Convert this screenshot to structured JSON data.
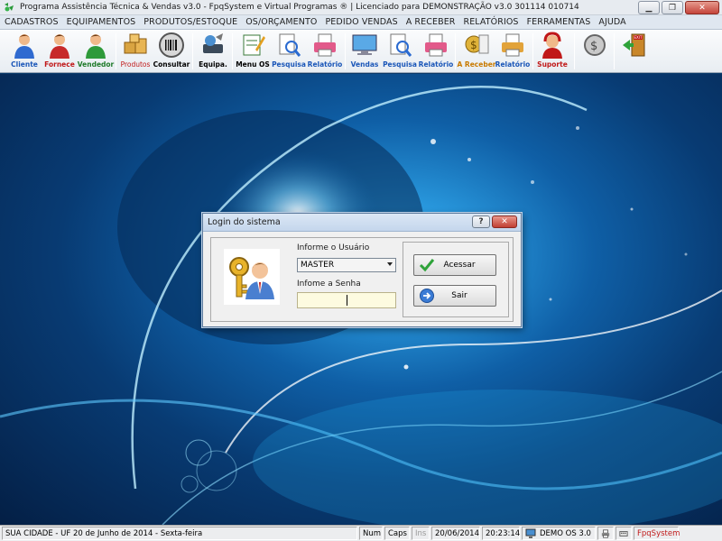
{
  "window": {
    "title": "Programa Assistência Técnica & Vendas v3.0 - FpqSystem e Virtual Programas ® | Licenciado para  DEMONSTRAÇÃO v3.0 301114 010714"
  },
  "menu": [
    "CADASTROS",
    "EQUIPAMENTOS",
    "PRODUTOS/ESTOQUE",
    "OS/ORÇAMENTO",
    "PEDIDO VENDAS",
    "A RECEBER",
    "RELATÓRIOS",
    "FERRAMENTAS",
    "AJUDA"
  ],
  "toolbar": {
    "cliente": "Cliente",
    "fornece": "Fornece",
    "vendedor": "Vendedor",
    "produtos": "Produtos",
    "consultar": "Consultar",
    "equipa": "Equipa.",
    "menu_os": "Menu OS",
    "pesquisa1": "Pesquisa",
    "relatorio1": "Relatório",
    "vendas": "Vendas",
    "pesquisa2": "Pesquisa",
    "relatorio2": "Relatório",
    "a_receber": "A Receber",
    "relatorio3": "Relatório",
    "suporte": "Suporte"
  },
  "login": {
    "title": "Login do sistema",
    "help": "?",
    "close": "✕",
    "user_label": "Informe o Usuário",
    "user_value": "MASTER",
    "password_label": "Infome a Senha",
    "acessar": "Acessar",
    "sair": "Sair"
  },
  "status": {
    "city": "SUA CIDADE - UF 20 de Junho de 2014 - Sexta-feira",
    "num": "Num",
    "caps": "Caps",
    "ins": "Ins",
    "date": "20/06/2014",
    "time": "20:23:14",
    "demo": "DEMO OS 3.0",
    "brand": "FpqSystem"
  },
  "colors": {
    "label_blue": "#1a56b8",
    "label_red": "#c01818",
    "label_orange": "#c87a00",
    "desktop_blue": "#0f5fa6"
  }
}
